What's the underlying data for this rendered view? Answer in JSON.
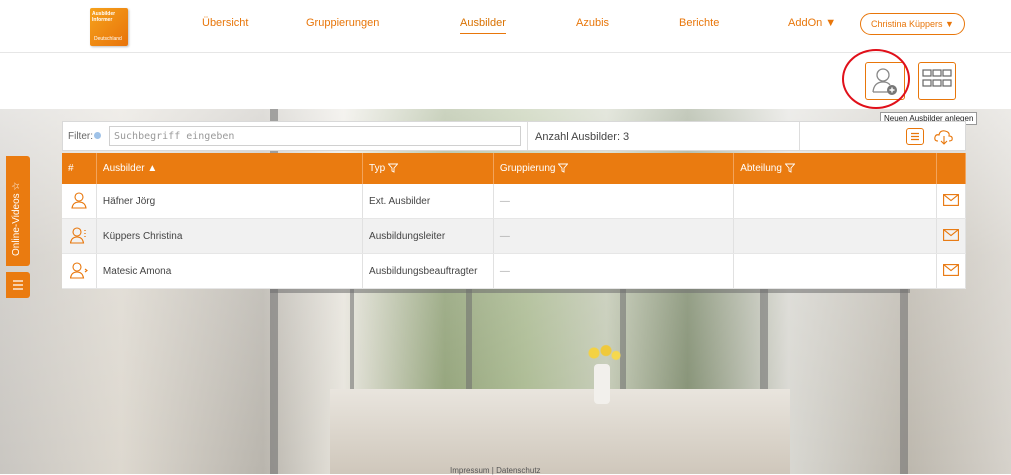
{
  "brand": {
    "logo_line1": "Ausbilder",
    "logo_line2": "Informer",
    "logo_line3": "Deutschland"
  },
  "nav": {
    "items": [
      {
        "label": "Übersicht"
      },
      {
        "label": "Gruppierungen"
      },
      {
        "label": "Ausbilder"
      },
      {
        "label": "Azubis"
      },
      {
        "label": "Berichte"
      },
      {
        "label": "AddOn ▼"
      }
    ],
    "user_menu": "Christina Küppers ▼"
  },
  "actions": {
    "add_icon": "user-add-icon",
    "tile_icon": "grid-view-icon",
    "tooltip": "Neuen Ausbilder anlegen"
  },
  "filter": {
    "label": "Filter:",
    "placeholder": "Suchbegriff eingeben",
    "count_text": "Anzahl Ausbilder: 3"
  },
  "table": {
    "headers": {
      "num": "#",
      "name": "Ausbilder ▲",
      "type": "Typ",
      "group": "Gruppierung",
      "dept": "Abteilung"
    },
    "rows": [
      {
        "name": "Häfner Jörg",
        "type": "Ext. Ausbilder",
        "group": "—",
        "dept": ""
      },
      {
        "name": "Küppers Christina",
        "type": "Ausbildungsleiter",
        "group": "—",
        "dept": ""
      },
      {
        "name": "Matesic Amona",
        "type": "Ausbildungsbeauftragter",
        "group": "—",
        "dept": ""
      }
    ]
  },
  "sidebar": {
    "videos_tab": "Online-Videos ☆"
  },
  "footer": {
    "links": "Impressum | Datenschutz"
  },
  "colors": {
    "accent": "#ea7b10",
    "highlight_ring": "#e0101a"
  }
}
